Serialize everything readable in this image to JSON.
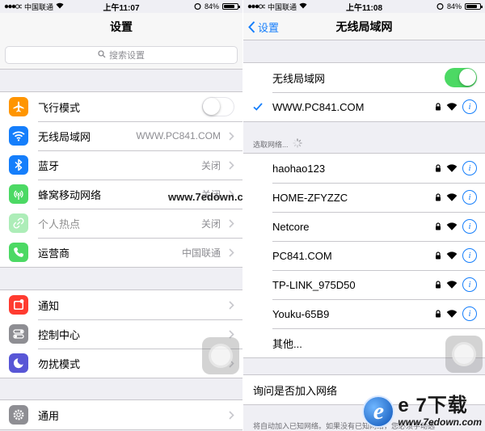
{
  "left": {
    "status": {
      "carrier": "中国联通",
      "time": "上午11:07",
      "battery": "84%"
    },
    "title": "设置",
    "search": {
      "placeholder": "搜索设置"
    },
    "groups": [
      [
        {
          "label": "飞行模式",
          "icon": "airplane-icon",
          "color": "#ff9500",
          "control": "toggle-off"
        },
        {
          "label": "无线局域网",
          "icon": "wifi-icon",
          "color": "#157efb",
          "value": "WWW.PC841.COM"
        },
        {
          "label": "蓝牙",
          "icon": "bluetooth-icon",
          "color": "#157efb",
          "value": "关闭"
        },
        {
          "label": "蜂窝移动网络",
          "icon": "cellular-icon",
          "color": "#4cd964",
          "value": "关闭"
        },
        {
          "label": "个人热点",
          "icon": "hotspot-icon",
          "color": "#4cd964",
          "value": "关闭",
          "dimmed": true
        },
        {
          "label": "运营商",
          "icon": "phone-icon",
          "color": "#4cd964",
          "value": "中国联通"
        }
      ],
      [
        {
          "label": "通知",
          "icon": "notifications-icon",
          "color": "#ff3b30"
        },
        {
          "label": "控制中心",
          "icon": "control-center-icon",
          "color": "#8e8e93"
        },
        {
          "label": "勿扰模式",
          "icon": "moon-icon",
          "color": "#5856d6"
        }
      ],
      [
        {
          "label": "通用",
          "icon": "gear-icon",
          "color": "#8e8e93"
        }
      ]
    ]
  },
  "right": {
    "status": {
      "carrier": "中国联通",
      "time": "上午11:08",
      "battery": "84%"
    },
    "back_label": "设置",
    "title": "无线局域网",
    "wifi_toggle_label": "无线局域网",
    "connected_network": "WWW.PC841.COM",
    "choose_network_header": "选取网络...",
    "networks": [
      "haohao123",
      "HOME-ZFYZZC",
      "Netcore",
      "PC841.COM",
      "TP-LINK_975D50",
      "Youku-65B9"
    ],
    "other_label": "其他...",
    "ask_to_join_label": "询问是否加入网络",
    "ask_footer": "将自动加入已知网络。如果没有已知网络，您必须手动选"
  },
  "watermarks": {
    "center": "www.7edown.com",
    "brand": "e 7下载",
    "url": "www.7edown.com"
  },
  "colors": {
    "accent": "#157efb",
    "toggle_on": "#4cd964",
    "group_bg": "#efeff4"
  }
}
